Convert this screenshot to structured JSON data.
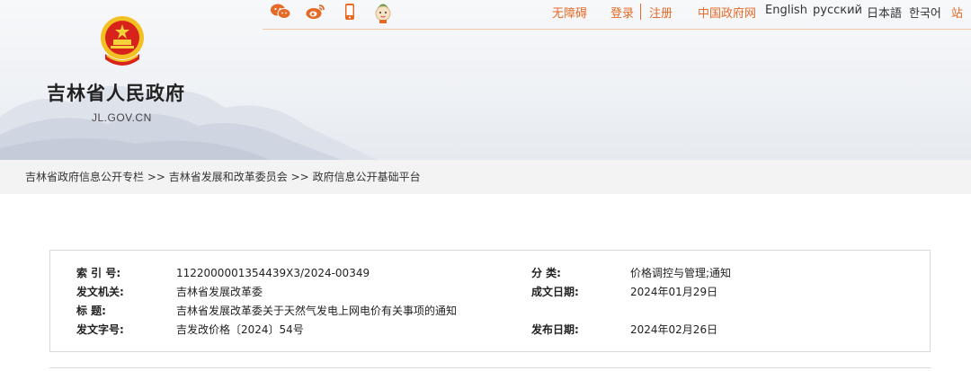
{
  "header": {
    "site_name": "吉林省人民政府",
    "site_domain": "JL.GOV.CN",
    "social_icons": [
      "wechat-icon",
      "weibo-icon",
      "mobile-icon",
      "mascot-icon"
    ],
    "nav": {
      "accessibility": "无障碍",
      "login": "登录",
      "register": "注册",
      "china_gov": "中国政府网",
      "english": "English",
      "russian": "русский",
      "japanese": "日本語",
      "korean": "한국어",
      "sitemap": "站群"
    },
    "accent_color": "#e56a25"
  },
  "breadcrumb": {
    "items": [
      "吉林省政府信息公开专栏",
      "吉林省发展和改革委员会",
      "政府信息公开基础平台"
    ],
    "separator": ">>"
  },
  "info": {
    "index_label": "索 引 号:",
    "index_value": "1122000001354439X3/2024-00349",
    "category_label": "分    类:",
    "category_value": "价格调控与管理;通知",
    "issuer_label": "发文机关:",
    "issuer_value": "吉林省发展改革委",
    "created_label": "成文日期:",
    "created_value": "2024年01月29日",
    "title_label": "标      题:",
    "title_value": "吉林省发展改革委关于天然气发电上网电价有关事项的通知",
    "docno_label": "发文字号:",
    "docno_value": "吉发改价格〔2024〕54号",
    "published_label": "发布日期:",
    "published_value": "2024年02月26日"
  }
}
